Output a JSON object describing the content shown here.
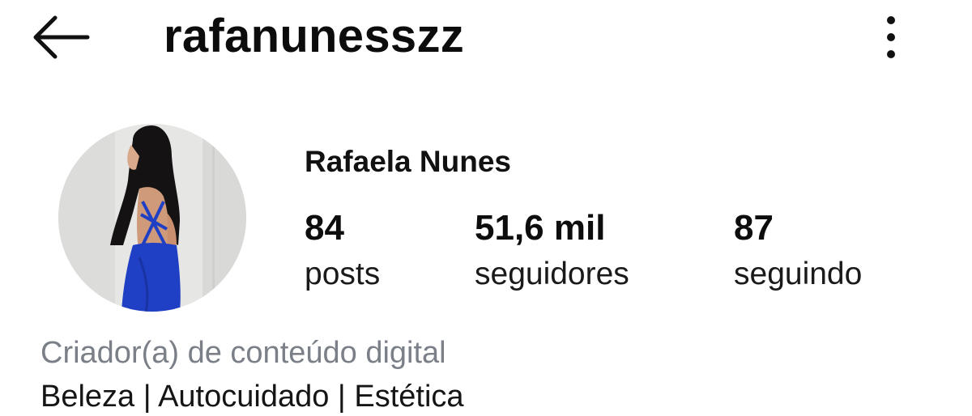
{
  "header": {
    "username": "rafanunesszz"
  },
  "icons": {
    "back": "arrow-left-icon",
    "more": "more-vertical-icon"
  },
  "profile": {
    "display_name": "Rafaela Nunes",
    "category": "Criador(a) de conteúdo digital",
    "bio": "Beleza | Autocuidado | Estética"
  },
  "stats": {
    "posts": {
      "value": "84",
      "label": "posts"
    },
    "followers": {
      "value": "51,6 mil",
      "label": "seguidores"
    },
    "following": {
      "value": "87",
      "label": "seguindo"
    }
  },
  "colors": {
    "text": "#0c0c0c",
    "category_text": "#7b8088",
    "dress": "#1f3fc4",
    "background": "#ffffff"
  }
}
